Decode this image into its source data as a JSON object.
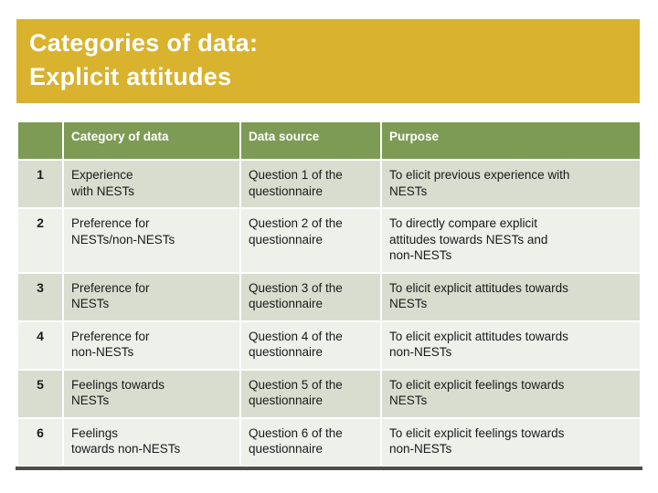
{
  "slide": {
    "title": {
      "line1": "Categories of data:",
      "line2": "Explicit attitudes",
      "banner_color": "#d9b22e",
      "text_color": "#ffffff"
    },
    "footer_rule_color": "#4d4d4d"
  },
  "table": {
    "header_bg": "#7d9b54",
    "row_odd_bg": "#d9ddd0",
    "row_even_bg": "#eef0ea",
    "headers": {
      "number": "",
      "category": "Category of data",
      "source": "Data source",
      "purpose": "Purpose"
    },
    "rows": [
      {
        "number": "1",
        "category": "Experience\nwith NESTs",
        "source": "Question 1 of the\nquestionnaire",
        "purpose": "To elicit previous experience with\nNESTs"
      },
      {
        "number": "2",
        "category": "Preference for\nNESTs/non-NESTs",
        "source": "Question 2 of the\nquestionnaire",
        "purpose": "To directly compare explicit\nattitudes towards NESTs and\nnon-NESTs"
      },
      {
        "number": "3",
        "category": "Preference for\nNESTs",
        "source": "Question 3 of the\nquestionnaire",
        "purpose": "To elicit explicit attitudes towards\nNESTs"
      },
      {
        "number": "4",
        "category": "Preference for\nnon-NESTs",
        "source": "Question 4 of the\nquestionnaire",
        "purpose": "To elicit explicit attitudes towards\nnon-NESTs"
      },
      {
        "number": "5",
        "category": "Feelings towards\nNESTs",
        "source": "Question 5 of the\nquestionnaire",
        "purpose": "To elicit explicit feelings towards\nNESTs"
      },
      {
        "number": "6",
        "category": "Feelings\ntowards non-NESTs",
        "source": "Question 6 of the\nquestionnaire",
        "purpose": "To elicit explicit feelings towards\nnon-NESTs"
      }
    ]
  }
}
